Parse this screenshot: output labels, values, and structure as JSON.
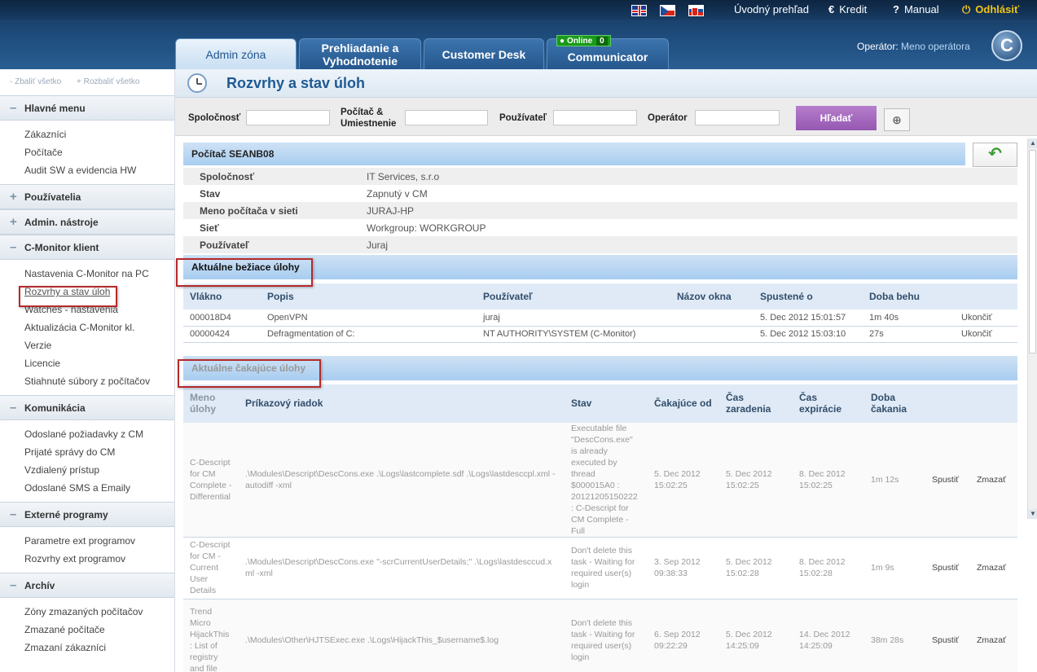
{
  "header": {
    "links": {
      "overview": "Úvodný prehľad",
      "credit": "Kredit",
      "manual": "Manual",
      "logout": "Odhlásiť"
    },
    "tabs": [
      {
        "label": "Admin zóna"
      },
      {
        "label": "Prehliadanie a Vyhodnotenie"
      },
      {
        "label": "Customer Desk"
      },
      {
        "label": "Communicator"
      }
    ],
    "online_label": "Online",
    "online_count": "0",
    "operator_label": "Operátor:",
    "operator_name": "Meno operátora",
    "logo": "C"
  },
  "sidebar": {
    "collapse_all": "- Zbaliť všetko",
    "expand_all": "+ Rozbaliť všetko",
    "sections": [
      {
        "title": "Hlavné menu",
        "sign": "–",
        "items": [
          "Zákazníci",
          "Počítače",
          "Audit SW a evidencia HW"
        ]
      },
      {
        "title": "Používatelia",
        "sign": "+",
        "items": []
      },
      {
        "title": "Admin. nástroje",
        "sign": "+",
        "items": []
      },
      {
        "title": "C-Monitor klient",
        "sign": "–",
        "items": [
          "Nastavenia C-Monitor na PC",
          "Rozvrhy a stav úloh",
          "Watches - nastavenia",
          "Aktualizácia C-Monitor kl.",
          "Verzie",
          "Licencie",
          "Stiahnuté súbory z počítačov"
        ]
      },
      {
        "title": "Komunikácia",
        "sign": "–",
        "items": [
          "Odoslané požiadavky z CM",
          "Prijaté správy do CM",
          "Vzdialený prístup",
          "Odoslané SMS a Emaily"
        ]
      },
      {
        "title": "Externé programy",
        "sign": "–",
        "items": [
          "Parametre ext programov",
          "Rozvrhy ext programov"
        ]
      },
      {
        "title": "Archív",
        "sign": "–",
        "items": [
          "Zóny zmazaných počítačov",
          "Zmazané počítače",
          "Zmazaní zákazníci"
        ]
      }
    ]
  },
  "page": {
    "title": "Rozvrhy a stav úloh",
    "filters": {
      "company": "Spoločnosť",
      "computer_line1": "Počítač &",
      "computer_line2": "Umiestnenie",
      "user": "Používateľ",
      "operator": "Operátor",
      "search_button": "Hľadať"
    },
    "computer_header": "Počítač SEANB08",
    "info": [
      {
        "k": "Spoločnosť",
        "v": "IT Services, s.r.o"
      },
      {
        "k": "Stav",
        "v": "Zapnutý v CM"
      },
      {
        "k": "Meno počítača v sieti",
        "v": "JURAJ-HP"
      },
      {
        "k": "Sieť",
        "v": "Workgroup: WORKGROUP"
      },
      {
        "k": "Používateľ",
        "v": "Juraj"
      }
    ],
    "running": {
      "title": "Aktuálne bežiace úlohy",
      "columns": [
        "Vlákno",
        "Popis",
        "Používateľ",
        "Názov okna",
        "Spustené o",
        "Doba behu",
        ""
      ],
      "rows": [
        [
          "000018D4",
          "OpenVPN",
          "juraj",
          "",
          "5. Dec 2012 15:01:57",
          "1m 40s",
          "Ukončiť"
        ],
        [
          "00000424",
          "Defragmentation of C:",
          "NT AUTHORITY\\SYSTEM (C-Monitor)",
          "",
          "5. Dec 2012 15:03:10",
          "27s",
          "Ukončiť"
        ]
      ]
    },
    "waiting": {
      "title": "Aktuálne čakajúce úlohy",
      "columns": [
        "Meno úlohy",
        "Príkazový riadok",
        "Stav",
        "Čakajúce od",
        "Čas zaradenia",
        "Čas expirácie",
        "Doba čakania",
        "",
        ""
      ],
      "rows": [
        [
          "C-Descript for CM Complete - Differential",
          ".\\Modules\\Descript\\DescCons.exe .\\Logs\\lastcomplete.sdf .\\Logs\\lastdesccpl.xml -autodiff -xml",
          "Executable file \"DescCons.exe\" is already executed by thread $000015A0 : 20121205150222 : C-Descript for CM Complete - Full",
          "5. Dec 2012 15:02:25",
          "5. Dec 2012 15:02:25",
          "8. Dec 2012 15:02:25",
          "1m 12s",
          "Spustiť",
          "Zmazať"
        ],
        [
          "C-Descript for CM - Current User Details",
          ".\\Modules\\Descript\\DescCons.exe \"-scrCurrentUserDetails;\" .\\Logs\\lastdesccud.xml -xml",
          "Don't delete this task - Waiting for required user(s) login",
          "3. Sep 2012 09:38:33",
          "5. Dec 2012 15:02:28",
          "8. Dec 2012 15:02:28",
          "1m 9s",
          "Spustiť",
          "Zmazať"
        ],
        [
          "Trend Micro HijackThis : List of registry and file",
          ".\\Modules\\Other\\HJTSExec.exe .\\Logs\\HijackThis_$username$.log",
          "Don't delete this task - Waiting for required user(s) login",
          "6. Sep 2012 09:22:29",
          "5. Dec 2012 14:25:09",
          "14. Dec 2012 14:25:09",
          "38m 28s",
          "Spustiť",
          "Zmazať"
        ]
      ]
    }
  },
  "colors": {
    "header": "#1f4d7e",
    "accent_blue": "#1e5a93",
    "search_button": "#9c61b8",
    "highlight_box": "#b42a2a",
    "online": "#1a9a1a"
  }
}
